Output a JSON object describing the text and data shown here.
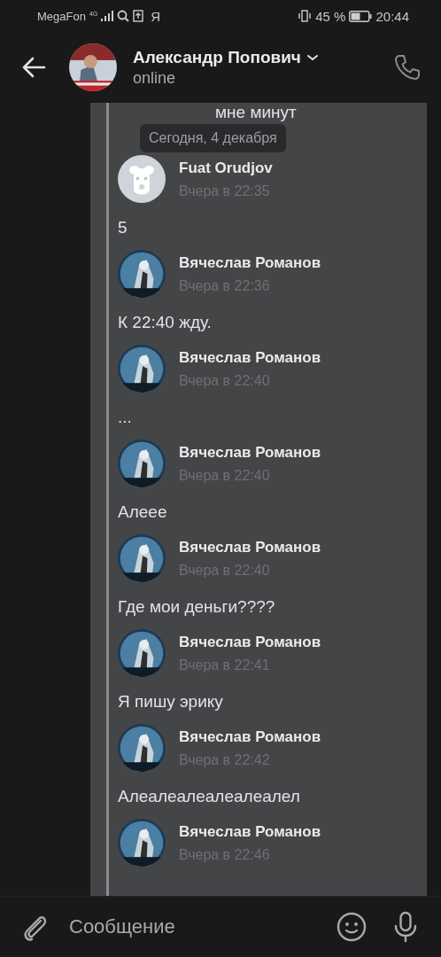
{
  "status_bar": {
    "carrier": "MegaFon",
    "network": "4G",
    "app_letter": "Я",
    "battery": "45 %",
    "time": "20:44"
  },
  "header": {
    "name": "Александр Попович",
    "status": "online"
  },
  "date_pill": "Сегодня, 4 декабря",
  "partial_text": "мне минут",
  "messages": [
    {
      "sender": "Fuat Orudjov",
      "time": "Вчера в 22:35",
      "kind": "dog",
      "text": "5"
    },
    {
      "sender": "Вячеслав Романов",
      "time": "Вчера в 22:36",
      "kind": "picture",
      "text": "К 22:40 жду."
    },
    {
      "sender": "Вячеслав Романов",
      "time": "Вчера в 22:40",
      "kind": "picture",
      "text": "..."
    },
    {
      "sender": "Вячеслав Романов",
      "time": "Вчера в 22:40",
      "kind": "picture",
      "text": "Алеее"
    },
    {
      "sender": "Вячеслав Романов",
      "time": "Вчера в 22:40",
      "kind": "picture",
      "text": "Где мои деньги????"
    },
    {
      "sender": "Вячеслав Романов",
      "time": "Вчера в 22:41",
      "kind": "picture",
      "text": "Я пишу эрику"
    },
    {
      "sender": "Вячеслав Романов",
      "time": "Вчера в 22:42",
      "kind": "picture",
      "text": "Алеалеалеалеалеалел"
    },
    {
      "sender": "Вячеслав Романов",
      "time": "Вчера в 22:46",
      "kind": "picture"
    }
  ],
  "composer": {
    "placeholder": "Сообщение"
  }
}
